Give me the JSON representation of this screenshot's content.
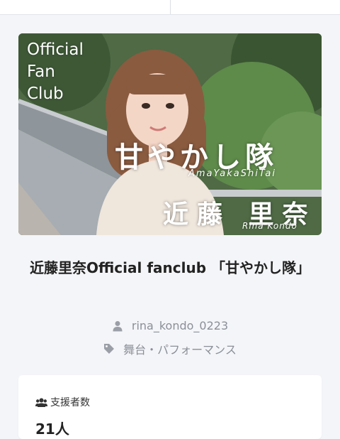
{
  "hero": {
    "logo_lines": [
      "Official",
      "Fan",
      "Club"
    ],
    "title": "甘やかし隊",
    "title_romaji": "AmaYakaShiTai",
    "name": "近藤 里奈",
    "name_romaji": "Rina Kondo"
  },
  "fanclub": {
    "title": "近藤里奈Official fanclub 「甘やかし隊」",
    "username": "rina_kondo_0223",
    "category": "舞台・パフォーマンス",
    "icons": {
      "user": "user-icon",
      "category": "tag-icon",
      "supporters": "users-icon"
    }
  },
  "stats": {
    "supporters_label": "支援者数",
    "supporters_count": "21人"
  },
  "colors": {
    "background": "#f4f5f8",
    "card": "#ffffff",
    "meta_text": "#8b8f98",
    "title_text": "#222222"
  }
}
